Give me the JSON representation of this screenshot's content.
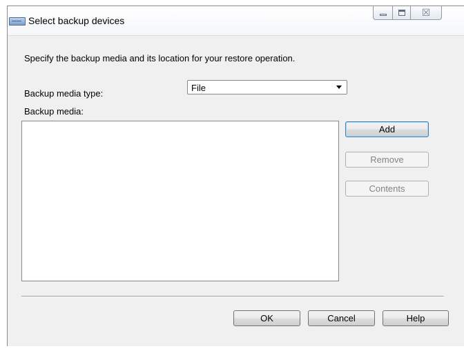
{
  "window": {
    "title": "Select backup devices",
    "icon": "window-app-icon",
    "controls": {
      "minimize": "minimize-icon",
      "maximize": "maximize-icon",
      "close_glyph": "☒"
    }
  },
  "form": {
    "description": "Specify the backup media and its location for your restore operation.",
    "media_type_label": "Backup media type:",
    "media_type_value": "File",
    "media_label": "Backup media:",
    "media_items": []
  },
  "side_buttons": {
    "add": "Add",
    "remove": "Remove",
    "contents": "Contents"
  },
  "footer": {
    "ok": "OK",
    "cancel": "Cancel",
    "help": "Help"
  },
  "colors": {
    "dialog_bg": "#f0f0f0",
    "default_button_border": "#3c7fb1",
    "disabled_text": "#838383"
  }
}
